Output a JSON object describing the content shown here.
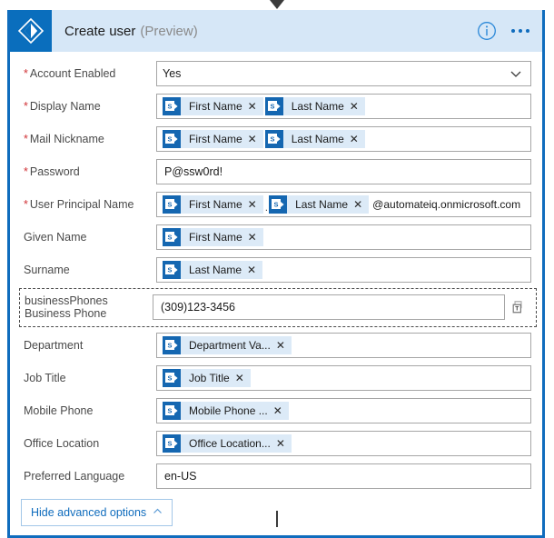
{
  "colors": {
    "accent": "#0f6cbd",
    "header_band": "#d6e7f7",
    "app_icon_bg": "#0a6ebd",
    "chip_bg": "#dceaf7",
    "chip_icon_bg": "#1567b1",
    "required_asterisk": "#d13438",
    "field_border": "#a6a6a6"
  },
  "header": {
    "app_icon": "azure-active-directory-icon",
    "title": "Create user",
    "preview_tag": "(Preview)",
    "info_icon": "info-icon",
    "menu_icon": "ellipsis-menu-icon"
  },
  "fields": [
    {
      "id": "account-enabled",
      "label": "Account Enabled",
      "required": true,
      "type": "dropdown",
      "value": "Yes"
    },
    {
      "id": "display-name",
      "label": "Display Name",
      "required": true,
      "type": "tokens",
      "tokens": [
        {
          "icon": "sharepoint-icon",
          "label": "First Name"
        },
        {
          "icon": "sharepoint-icon",
          "label": "Last Name"
        }
      ]
    },
    {
      "id": "mail-nickname",
      "label": "Mail Nickname",
      "required": true,
      "type": "tokens",
      "tokens": [
        {
          "icon": "sharepoint-icon",
          "label": "First Name"
        },
        {
          "icon": "sharepoint-icon",
          "label": "Last Name"
        }
      ]
    },
    {
      "id": "password",
      "label": "Password",
      "required": true,
      "type": "text",
      "value": "P@ssw0rd!"
    },
    {
      "id": "user-principal-name",
      "label": "User Principal Name",
      "required": true,
      "type": "tokens",
      "tokens": [
        {
          "icon": "sharepoint-icon",
          "label": "First Name"
        },
        {
          "icon": "sharepoint-icon",
          "label": "Last Name"
        }
      ],
      "separator": ".",
      "suffix": "@automateiq.onmicrosoft.com"
    },
    {
      "id": "given-name",
      "label": "Given Name",
      "required": false,
      "type": "tokens",
      "tokens": [
        {
          "icon": "sharepoint-icon",
          "label": "First Name"
        }
      ]
    },
    {
      "id": "surname",
      "label": "Surname",
      "required": false,
      "type": "tokens",
      "tokens": [
        {
          "icon": "sharepoint-icon",
          "label": "Last Name"
        }
      ]
    }
  ],
  "business_phone": {
    "id": "business-phones",
    "label_line1": "businessPhones",
    "label_line2": "Business Phone",
    "value": "(309)123-3456",
    "delete_icon": "delete-icon"
  },
  "fields_bottom": [
    {
      "id": "department",
      "label": "Department",
      "required": false,
      "type": "tokens",
      "tokens": [
        {
          "icon": "sharepoint-icon",
          "label": "Department Va..."
        }
      ]
    },
    {
      "id": "job-title",
      "label": "Job Title",
      "required": false,
      "type": "tokens",
      "tokens": [
        {
          "icon": "sharepoint-icon",
          "label": "Job Title"
        }
      ]
    },
    {
      "id": "mobile-phone",
      "label": "Mobile Phone",
      "required": false,
      "type": "tokens",
      "tokens": [
        {
          "icon": "sharepoint-icon",
          "label": "Mobile Phone ..."
        }
      ]
    },
    {
      "id": "office-location",
      "label": "Office Location",
      "required": false,
      "type": "tokens",
      "tokens": [
        {
          "icon": "sharepoint-icon",
          "label": "Office Location..."
        }
      ]
    },
    {
      "id": "preferred-language",
      "label": "Preferred Language",
      "required": false,
      "type": "text",
      "value": "en-US"
    }
  ],
  "footer": {
    "advanced_button_label": "Hide advanced options",
    "advanced_button_icon": "chevron-up-icon"
  }
}
